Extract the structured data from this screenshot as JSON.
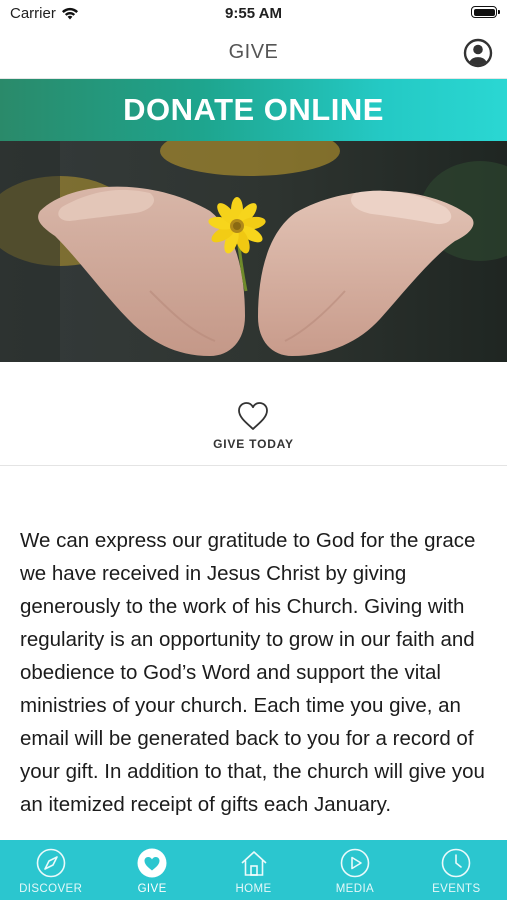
{
  "status_bar": {
    "carrier": "Carrier",
    "time": "9:55 AM",
    "wifi_icon": "wifi-icon",
    "battery_icon": "battery-icon"
  },
  "header": {
    "title": "GIVE",
    "profile_icon": "person-icon"
  },
  "banner": {
    "title": "DONATE ONLINE",
    "gradient_colors": [
      "#2a8a6a",
      "#2ad7d3"
    ]
  },
  "hero": {
    "icon": "photo-hands-holding-yellow-flower"
  },
  "give_today": {
    "icon": "heart-icon",
    "label": "GIVE TODAY"
  },
  "body": {
    "text": "We can express our gratitude to God for the grace we have received in Jesus Christ by giving generously to the work of his Church. Giving with regularity is an opportunity to grow in our faith and obedience to God’s Word and support the vital ministries of your church. Each time you give, an email will be generated back to you for a record of your gift. In addition to that, the church will give you an itemized receipt of gifts each January."
  },
  "tab_bar": {
    "background": "#2bc6cf",
    "tabs": [
      {
        "label": "DISCOVER",
        "icon": "compass-icon",
        "active": false
      },
      {
        "label": "GIVE",
        "icon": "heart-icon",
        "active": true
      },
      {
        "label": "HOME",
        "icon": "home-icon",
        "active": false
      },
      {
        "label": "MEDIA",
        "icon": "play-icon",
        "active": false
      },
      {
        "label": "EVENTS",
        "icon": "clock-icon",
        "active": false
      }
    ]
  }
}
